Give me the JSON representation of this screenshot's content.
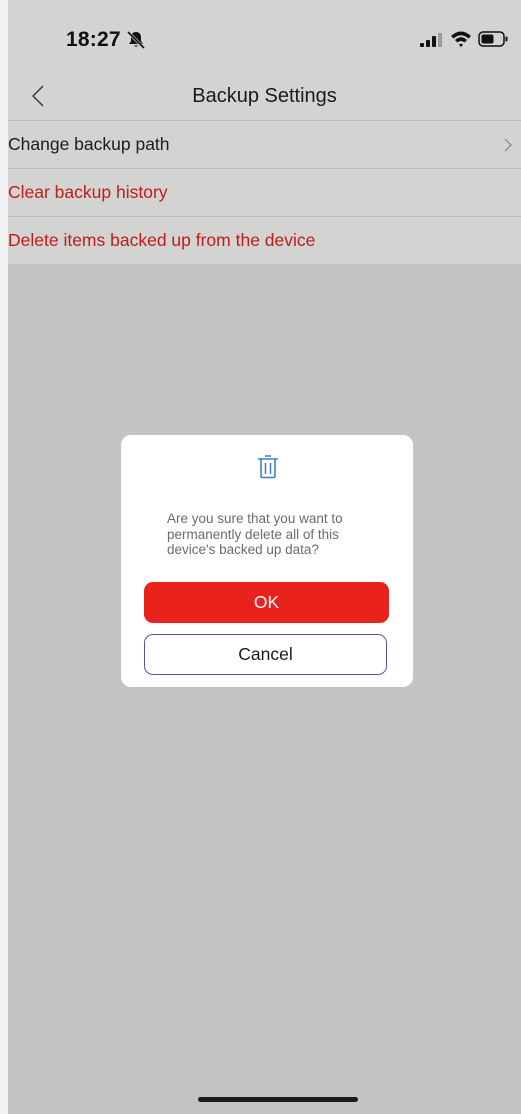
{
  "status_bar": {
    "time": "18:27",
    "icons": [
      "bell-slash-icon",
      "signal-icon",
      "wifi-icon",
      "battery-icon"
    ]
  },
  "header": {
    "title": "Backup Settings",
    "back_icon": "chevron-left-icon"
  },
  "settings": {
    "items": [
      {
        "label": "Change backup path",
        "style": "normal",
        "icon": "chevron-right-icon"
      },
      {
        "label": "Clear backup history",
        "style": "danger"
      },
      {
        "label": "Delete items backed up from the device",
        "style": "danger"
      }
    ]
  },
  "dialog": {
    "icon": "trash-icon",
    "message": "Are you sure that you want to permanently delete all of this device's backed up data?",
    "ok_label": "OK",
    "cancel_label": "Cancel"
  },
  "colors": {
    "danger_text": "#bf1c1c",
    "ok_button": "#e9221c",
    "cancel_border": "#4f58a6",
    "overlay": "#c4c3c1",
    "icon_blue": "#3f7fc4"
  }
}
